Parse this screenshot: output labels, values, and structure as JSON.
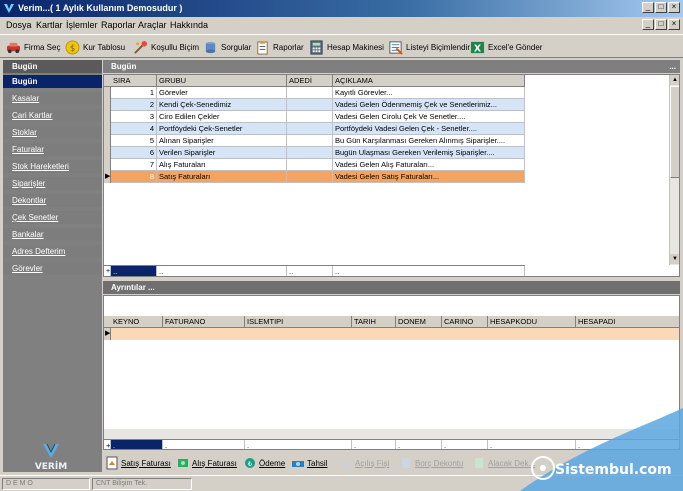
{
  "window": {
    "title": "Verim...( 1 Aylık Kullanım Demosudur )"
  },
  "menu": [
    "Dosya",
    "Kartlar",
    "İşlemler",
    "Raporlar",
    "Araçlar",
    "Hakkında"
  ],
  "toolbar": [
    {
      "label": "Firma Seç",
      "icon": "car-icon"
    },
    {
      "label": "Kur Tablosu",
      "icon": "coin-icon"
    },
    {
      "label": "Koşullu Biçim",
      "icon": "magic-icon"
    },
    {
      "label": "Sorgular",
      "icon": "query-icon"
    },
    {
      "label": "Raporlar",
      "icon": "report-icon"
    },
    {
      "label": "Hesap Makinesi",
      "icon": "calculator-icon"
    },
    {
      "label": "Listeyi Biçimlendir",
      "icon": "list-format-icon"
    },
    {
      "label": "Excel'e Gönder",
      "icon": "excel-icon"
    }
  ],
  "sidebar": {
    "items": [
      "Bugün",
      "Kasalar",
      "Cari Kartlar",
      "Stoklar",
      "Faturalar",
      "Stok Hareketleri",
      "Siparişler",
      "Dekontlar",
      "Çek Senetler",
      "Bankalar",
      "Adres Defterim",
      "Görevler"
    ],
    "active": "Bugün",
    "logo_text": "VERİM"
  },
  "top_panel": {
    "title": "Bugün",
    "dots": "...",
    "columns": [
      "SIRA",
      "GRUBU",
      "ADEDİ",
      "AÇIKLAMA"
    ],
    "rows": [
      {
        "sira": "1",
        "grubu": "Görevler",
        "adedi": "",
        "aciklama": "Kayıtlı Görevler..."
      },
      {
        "sira": "2",
        "grubu": "Kendi Çek-Senedimiz",
        "adedi": "",
        "aciklama": "Vadesi Gelen Ödenmemiş Çek ve Senetlerimiz..."
      },
      {
        "sira": "3",
        "grubu": "Ciro Edilen Çekler",
        "adedi": "",
        "aciklama": "Vadesi Gelen Cirolu Çek Ve Senetler...."
      },
      {
        "sira": "4",
        "grubu": "Portföydeki Çek-Senetler",
        "adedi": "",
        "aciklama": "Portföydeki Vadesi Gelen Çek - Senetler...."
      },
      {
        "sira": "5",
        "grubu": "Alınan Siparişler",
        "adedi": "",
        "aciklama": "Bu Gün Karşılanması Gereken Alınmış Siparişler...."
      },
      {
        "sira": "6",
        "grubu": "Verilen Siparişler",
        "adedi": "",
        "aciklama": "Bugün Ulaşması Gereken Verilemiş Siparişler...."
      },
      {
        "sira": "7",
        "grubu": "Alış Faturaları",
        "adedi": "",
        "aciklama": "Vadesi Gelen Alış Faturaları..."
      },
      {
        "sira": "8",
        "grubu": "Satış Faturaları",
        "adedi": "",
        "aciklama": "Vadesi Gelen Satış Faturaları..."
      }
    ],
    "selected_row": 8,
    "footer": [
      "..",
      "..",
      "..",
      ".."
    ]
  },
  "bottom_panel": {
    "title": "Ayrıntılar ...",
    "columns": [
      "KEYNO",
      "FATURANO",
      "ISLEMTIPI",
      "TARIH",
      "DONEM",
      "CARINO",
      "HESAPKODU",
      "HESAPADI"
    ],
    "footer": [
      ".",
      ".",
      ".",
      ".",
      ".",
      ".",
      ".",
      "."
    ]
  },
  "bottom_tabs": [
    {
      "label": "Satış Faturası",
      "enabled": true,
      "icon": "sales-invoice-icon"
    },
    {
      "label": "Alış Faturası",
      "enabled": true,
      "icon": "purchase-invoice-icon"
    },
    {
      "label": "Ödeme",
      "enabled": true,
      "icon": "payment-icon"
    },
    {
      "label": "Tahsil",
      "enabled": true,
      "icon": "collection-icon"
    },
    {
      "label": "Açılış Fişi",
      "enabled": false,
      "icon": "opening-slip-icon"
    },
    {
      "label": "Borç Dekontu",
      "enabled": false,
      "icon": "debit-note-icon"
    },
    {
      "label": "Alacak Dek...",
      "enabled": false,
      "icon": "credit-note-icon"
    }
  ],
  "statusbar": {
    "left": "D E M O",
    "middle": "CNT Bilişim Tek."
  },
  "watermark": {
    "text": "Sistembul.com"
  },
  "colors": {
    "selected_row": "#f4a460",
    "alt_row": "#d6e4f7",
    "sidebar_active": "#0a246a"
  }
}
